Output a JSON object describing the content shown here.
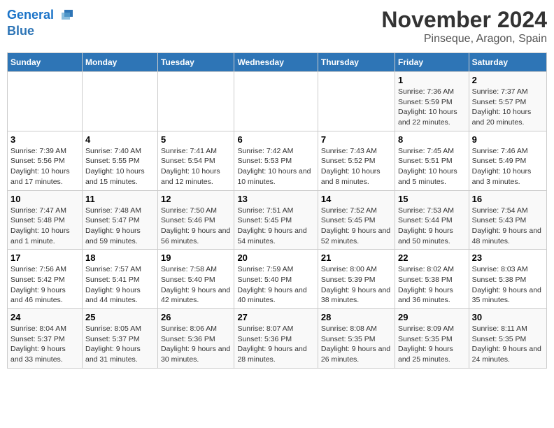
{
  "header": {
    "logo_line1": "General",
    "logo_line2": "Blue",
    "month": "November 2024",
    "location": "Pinseque, Aragon, Spain"
  },
  "weekdays": [
    "Sunday",
    "Monday",
    "Tuesday",
    "Wednesday",
    "Thursday",
    "Friday",
    "Saturday"
  ],
  "weeks": [
    [
      {
        "day": "",
        "info": ""
      },
      {
        "day": "",
        "info": ""
      },
      {
        "day": "",
        "info": ""
      },
      {
        "day": "",
        "info": ""
      },
      {
        "day": "",
        "info": ""
      },
      {
        "day": "1",
        "info": "Sunrise: 7:36 AM\nSunset: 5:59 PM\nDaylight: 10 hours and 22 minutes."
      },
      {
        "day": "2",
        "info": "Sunrise: 7:37 AM\nSunset: 5:57 PM\nDaylight: 10 hours and 20 minutes."
      }
    ],
    [
      {
        "day": "3",
        "info": "Sunrise: 7:39 AM\nSunset: 5:56 PM\nDaylight: 10 hours and 17 minutes."
      },
      {
        "day": "4",
        "info": "Sunrise: 7:40 AM\nSunset: 5:55 PM\nDaylight: 10 hours and 15 minutes."
      },
      {
        "day": "5",
        "info": "Sunrise: 7:41 AM\nSunset: 5:54 PM\nDaylight: 10 hours and 12 minutes."
      },
      {
        "day": "6",
        "info": "Sunrise: 7:42 AM\nSunset: 5:53 PM\nDaylight: 10 hours and 10 minutes."
      },
      {
        "day": "7",
        "info": "Sunrise: 7:43 AM\nSunset: 5:52 PM\nDaylight: 10 hours and 8 minutes."
      },
      {
        "day": "8",
        "info": "Sunrise: 7:45 AM\nSunset: 5:51 PM\nDaylight: 10 hours and 5 minutes."
      },
      {
        "day": "9",
        "info": "Sunrise: 7:46 AM\nSunset: 5:49 PM\nDaylight: 10 hours and 3 minutes."
      }
    ],
    [
      {
        "day": "10",
        "info": "Sunrise: 7:47 AM\nSunset: 5:48 PM\nDaylight: 10 hours and 1 minute."
      },
      {
        "day": "11",
        "info": "Sunrise: 7:48 AM\nSunset: 5:47 PM\nDaylight: 9 hours and 59 minutes."
      },
      {
        "day": "12",
        "info": "Sunrise: 7:50 AM\nSunset: 5:46 PM\nDaylight: 9 hours and 56 minutes."
      },
      {
        "day": "13",
        "info": "Sunrise: 7:51 AM\nSunset: 5:45 PM\nDaylight: 9 hours and 54 minutes."
      },
      {
        "day": "14",
        "info": "Sunrise: 7:52 AM\nSunset: 5:45 PM\nDaylight: 9 hours and 52 minutes."
      },
      {
        "day": "15",
        "info": "Sunrise: 7:53 AM\nSunset: 5:44 PM\nDaylight: 9 hours and 50 minutes."
      },
      {
        "day": "16",
        "info": "Sunrise: 7:54 AM\nSunset: 5:43 PM\nDaylight: 9 hours and 48 minutes."
      }
    ],
    [
      {
        "day": "17",
        "info": "Sunrise: 7:56 AM\nSunset: 5:42 PM\nDaylight: 9 hours and 46 minutes."
      },
      {
        "day": "18",
        "info": "Sunrise: 7:57 AM\nSunset: 5:41 PM\nDaylight: 9 hours and 44 minutes."
      },
      {
        "day": "19",
        "info": "Sunrise: 7:58 AM\nSunset: 5:40 PM\nDaylight: 9 hours and 42 minutes."
      },
      {
        "day": "20",
        "info": "Sunrise: 7:59 AM\nSunset: 5:40 PM\nDaylight: 9 hours and 40 minutes."
      },
      {
        "day": "21",
        "info": "Sunrise: 8:00 AM\nSunset: 5:39 PM\nDaylight: 9 hours and 38 minutes."
      },
      {
        "day": "22",
        "info": "Sunrise: 8:02 AM\nSunset: 5:38 PM\nDaylight: 9 hours and 36 minutes."
      },
      {
        "day": "23",
        "info": "Sunrise: 8:03 AM\nSunset: 5:38 PM\nDaylight: 9 hours and 35 minutes."
      }
    ],
    [
      {
        "day": "24",
        "info": "Sunrise: 8:04 AM\nSunset: 5:37 PM\nDaylight: 9 hours and 33 minutes."
      },
      {
        "day": "25",
        "info": "Sunrise: 8:05 AM\nSunset: 5:37 PM\nDaylight: 9 hours and 31 minutes."
      },
      {
        "day": "26",
        "info": "Sunrise: 8:06 AM\nSunset: 5:36 PM\nDaylight: 9 hours and 30 minutes."
      },
      {
        "day": "27",
        "info": "Sunrise: 8:07 AM\nSunset: 5:36 PM\nDaylight: 9 hours and 28 minutes."
      },
      {
        "day": "28",
        "info": "Sunrise: 8:08 AM\nSunset: 5:35 PM\nDaylight: 9 hours and 26 minutes."
      },
      {
        "day": "29",
        "info": "Sunrise: 8:09 AM\nSunset: 5:35 PM\nDaylight: 9 hours and 25 minutes."
      },
      {
        "day": "30",
        "info": "Sunrise: 8:11 AM\nSunset: 5:35 PM\nDaylight: 9 hours and 24 minutes."
      }
    ]
  ]
}
